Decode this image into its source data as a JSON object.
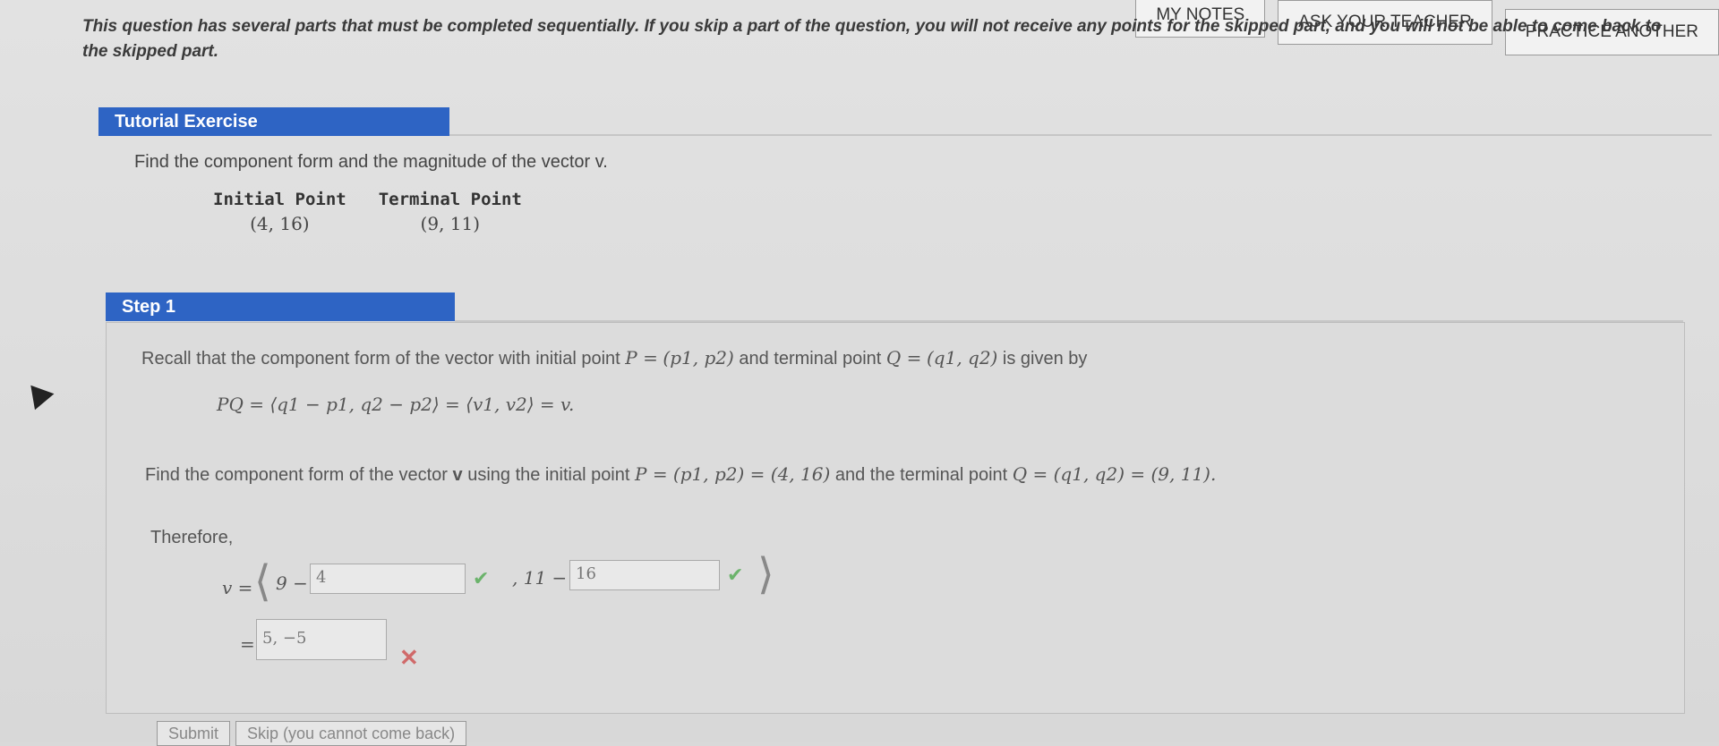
{
  "top_buttons": {
    "my_notes": "MY NOTES",
    "ask_teacher": "ASK YOUR TEACHER",
    "practice_another": "PRACTICE ANOTHER"
  },
  "intro_text": "This question has several parts that must be completed sequentially. If you skip a part of the question, you will not receive any points for the skipped part, and you will not be able to come back to the skipped part.",
  "tutorial": {
    "header": "Tutorial Exercise",
    "prompt": "Find the component form and the magnitude of the vector v.",
    "initial_label": "Initial Point",
    "initial_value": "(4, 16)",
    "terminal_label": "Terminal Point",
    "terminal_value": "(9, 11)"
  },
  "step1": {
    "header": "Step 1",
    "recall_text_1": "Recall that the component form of the vector with initial point",
    "recall_p": "P =",
    "recall_p_val": "(p1, p2)",
    "recall_text_2": "and terminal point",
    "recall_q": "Q =",
    "recall_q_val": "(q1, q2)",
    "recall_text_3": "is given by",
    "formula": "PQ = ⟨q1 − p1, q2 − p2⟩ = ⟨v1, v2⟩ = v.",
    "find_text_1": "Find the component form of the vector",
    "find_text_v": "v",
    "find_text_2": "using the initial point",
    "find_p": "P = (p1, p2) = (4, 16)",
    "find_text_3": "and the terminal point",
    "find_q": "Q = (q1, q2) = (9, 11).",
    "therefore": "Therefore,",
    "v_eq": "v =",
    "first_lhs": "9 −",
    "first_input": "4",
    "comma_second": ", 11 −",
    "second_input": "16",
    "eq": "=",
    "result_input": "5, −5",
    "check_mark": "✔",
    "x_mark": "✕",
    "open_bracket": "⟨",
    "close_bracket": "⟩"
  },
  "bottom": {
    "submit": "Submit",
    "skip": "Skip (you cannot come back)"
  }
}
